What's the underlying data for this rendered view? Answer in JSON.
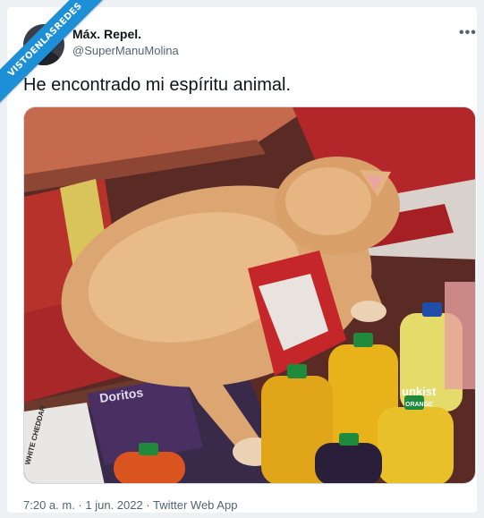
{
  "watermark": {
    "text": "VISTOENLASREDES"
  },
  "tweet": {
    "display_name": "Máx. Repel.",
    "handle": "@SuperManuMolina",
    "more_icon": "•••",
    "text": "He encontrado mi espíritu animal.",
    "timestamp": "7:20 a. m. · 1 jun. 2022 · Twitter Web App"
  },
  "photo": {
    "labels": {
      "doritos": "Doritos",
      "white_cheddar": "WHITE CHEDDAR",
      "bottle_a": "unkist",
      "bottle_b": "ORANGE"
    }
  },
  "colors": {
    "brand_blue": "#1d8fd6",
    "text_primary": "#0f1419",
    "text_secondary": "#536471"
  }
}
